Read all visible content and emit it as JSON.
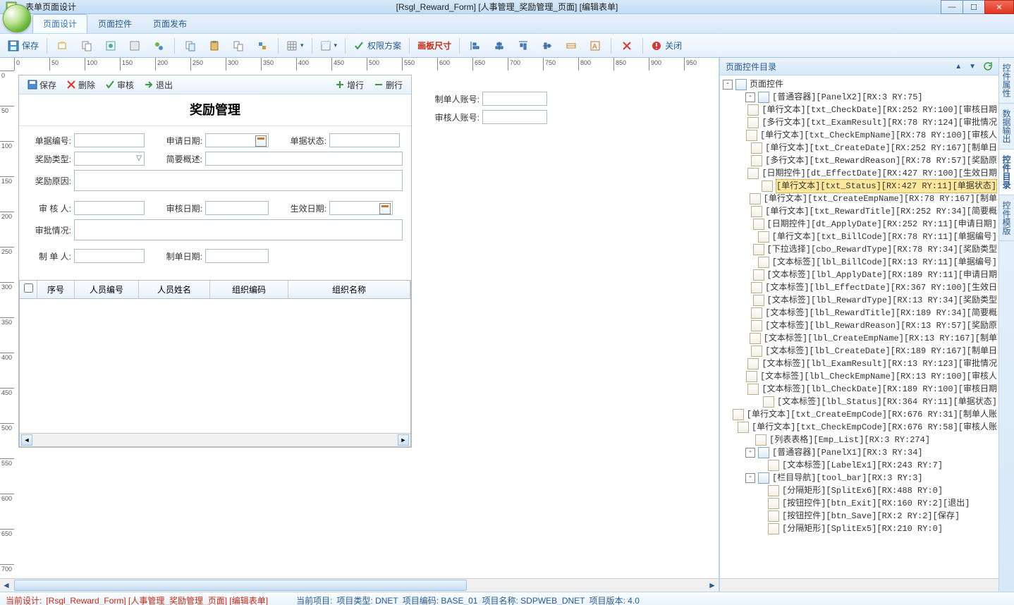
{
  "title_bar": {
    "app_name": "表单页面设计",
    "doc_title": "[Rsgl_Reward_Form] [人事管理_奖励管理_页面] [编辑表单]"
  },
  "ribbon": {
    "tabs": {
      "design": "页面设计",
      "controls": "页面控件",
      "publish": "页面发布"
    }
  },
  "toolbar": {
    "save": "保存",
    "perm": "权限方案",
    "size": "画板尺寸",
    "close": "关闭"
  },
  "form": {
    "toolbar": {
      "save": "保存",
      "delete": "删除",
      "audit": "审核",
      "exit": "退出",
      "addrow": "增行",
      "delrow": "删行"
    },
    "title": "奖励管理",
    "labels": {
      "bill_code": "单据编号:",
      "apply_date": "申请日期:",
      "status": "单据状态:",
      "reward_type": "奖励类型:",
      "reward_title": "简要概述:",
      "reward_reason": "奖励原因:",
      "check_emp": "审 核 人:",
      "check_date": "审核日期:",
      "effect_date": "生效日期:",
      "exam_result": "审批情况:",
      "create_emp": "制 单 人:",
      "create_date": "制单日期:"
    },
    "aux": {
      "create_emp_code": "制单人账号:",
      "check_emp_code": "审核人账号:"
    },
    "grid_headers": {
      "chk": "",
      "seq": "序号",
      "emp_code": "人员编号",
      "emp_name": "人员姓名",
      "org_code": "组织编码",
      "org_name": "组织名称"
    }
  },
  "right_pane": {
    "title": "页面控件目录",
    "root": "页面控件",
    "nodes": [
      {
        "d": 1,
        "exp": "-",
        "t": "[普通容器][PanelX2][RX:3 RY:75]",
        "c": true
      },
      {
        "d": 2,
        "t": "[单行文本][txt_CheckDate][RX:252  RY:100][审核日期"
      },
      {
        "d": 2,
        "t": "[多行文本][txt_ExamResult][RX:78  RY:124][审批情况"
      },
      {
        "d": 2,
        "t": "[单行文本][txt_CheckEmpName][RX:78  RY:100][审核人"
      },
      {
        "d": 2,
        "t": "[单行文本][txt_CreateDate][RX:252  RY:167][制单日"
      },
      {
        "d": 2,
        "t": "[多行文本][txt_RewardReason][RX:78  RY:57][奖励原"
      },
      {
        "d": 2,
        "t": "[日期控件][dt_EffectDate][RX:427  RY:100][生效日期"
      },
      {
        "d": 2,
        "t": "[单行文本][txt_Status][RX:427  RY:11][单据状态]",
        "sel": true
      },
      {
        "d": 2,
        "t": "[单行文本][txt_CreateEmpName][RX:78  RY:167][制单"
      },
      {
        "d": 2,
        "t": "[单行文本][txt_RewardTitle][RX:252  RY:34][简要概"
      },
      {
        "d": 2,
        "t": "[日期控件][dt_ApplyDate][RX:252  RY:11][申请日期]"
      },
      {
        "d": 2,
        "t": "[单行文本][txt_BillCode][RX:78  RY:11][单据编号]"
      },
      {
        "d": 2,
        "t": "[下拉选择][cbo_RewardType][RX:78  RY:34][奖励类型"
      },
      {
        "d": 2,
        "t": "[文本标签][lbl_BillCode][RX:13  RY:11][单据编号]"
      },
      {
        "d": 2,
        "t": "[文本标签][lbl_ApplyDate][RX:189  RY:11][申请日期"
      },
      {
        "d": 2,
        "t": "[文本标签][lbl_EffectDate][RX:367  RY:100][生效日"
      },
      {
        "d": 2,
        "t": "[文本标签][lbl_RewardType][RX:13  RY:34][奖励类型"
      },
      {
        "d": 2,
        "t": "[文本标签][lbl_RewardTitle][RX:189  RY:34][简要概"
      },
      {
        "d": 2,
        "t": "[文本标签][lbl_RewardReason][RX:13  RY:57][奖励原"
      },
      {
        "d": 2,
        "t": "[文本标签][lbl_CreateEmpName][RX:13  RY:167][制单"
      },
      {
        "d": 2,
        "t": "[文本标签][lbl_CreateDate][RX:189  RY:167][制单日"
      },
      {
        "d": 2,
        "t": "[文本标签][lbl_ExamResult][RX:13  RY:123][审批情况"
      },
      {
        "d": 2,
        "t": "[文本标签][lbl_CheckEmpName][RX:13  RY:100][审核人"
      },
      {
        "d": 2,
        "t": "[文本标签][lbl_CheckDate][RX:189  RY:100][审核日期"
      },
      {
        "d": 2,
        "t": "[文本标签][lbl_Status][RX:364  RY:11][单据状态]"
      },
      {
        "d": 1,
        "t": "[单行文本][txt_CreateEmpCode][RX:676  RY:31][制单人账"
      },
      {
        "d": 1,
        "t": "[单行文本][txt_CheckEmpCode][RX:676  RY:58][审核人账"
      },
      {
        "d": 1,
        "t": "[列表表格][Emp_List][RX:3 RY:274]"
      },
      {
        "d": 1,
        "exp": "-",
        "t": "[普通容器][PanelX1][RX:3 RY:34]",
        "c": true
      },
      {
        "d": 2,
        "t": "[文本标签][LabelEx1][RX:243 RY:7]"
      },
      {
        "d": 1,
        "exp": "-",
        "t": "[栏目导航][tool_bar][RX:3 RY:3]",
        "c": true
      },
      {
        "d": 2,
        "t": "[分隔矩形][SplitEx6][RX:488 RY:0]"
      },
      {
        "d": 2,
        "t": "[按钮控件][btn_Exit][RX:160  RY:2][退出]"
      },
      {
        "d": 2,
        "t": "[按钮控件][btn_Save][RX:2  RY:2][保存]"
      },
      {
        "d": 2,
        "t": "[分隔矩形][SplitEx5][RX:210 RY:0]"
      }
    ]
  },
  "side_tabs": {
    "prop": "控件属性",
    "ds": "数据输出",
    "dir": "控件目录",
    "tpl": "控件模版"
  },
  "status": {
    "design_label": "当前设计:",
    "design_value": "[Rsgl_Reward_Form] [人事管理_奖励管理_页面] [编辑表单]",
    "project_label": "当前项目:",
    "proj_type": "项目类型: DNET",
    "proj_code": "项目编码: BASE_01",
    "proj_name": "项目名称: SDPWEB_DNET",
    "proj_ver": "项目版本: 4.0"
  }
}
